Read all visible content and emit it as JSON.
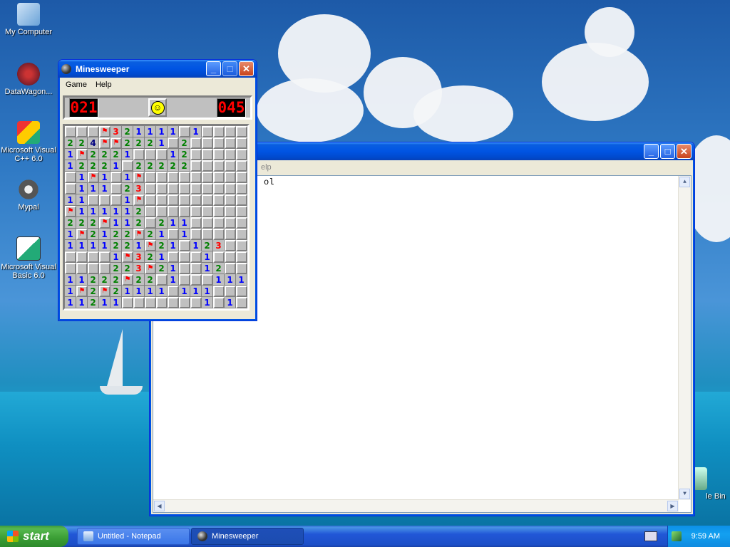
{
  "desktop": {
    "icons": [
      {
        "label": "My Computer"
      },
      {
        "label": "DataWagon..."
      },
      {
        "label": "Microsoft Visual C++ 6.0"
      },
      {
        "label": "Mypal"
      },
      {
        "label": "Microsoft Visual Basic 6.0"
      },
      {
        "label": "le Bin"
      }
    ]
  },
  "notepad": {
    "menu_fragment": "elp",
    "text_fragment": "ol"
  },
  "minesweeper": {
    "title": "Minesweeper",
    "menu": [
      "Game",
      "Help"
    ],
    "mine_counter": "021",
    "timer": "045",
    "grid": [
      "...F3211T1.1....",
      "224FF2221.2.....",
      "1F2221...12.....",
      "12221.22222.....",
      ".1F1.1F.........",
      ".111.23.........",
      "11...1F.........",
      "F111112.........",
      "222F112.211.....",
      "1F2122F21.1.....",
      "1111221F21.123..",
      "....1F321...1...",
      "....223F21..12..",
      "11222F22.1...111",
      "1F2F21111.111...",
      "11211.......1.1."
    ]
  },
  "taskbar": {
    "start_label": "start",
    "tasks": [
      "Untitled - Notepad",
      "Minesweeper"
    ],
    "clock": "9:59 AM"
  }
}
